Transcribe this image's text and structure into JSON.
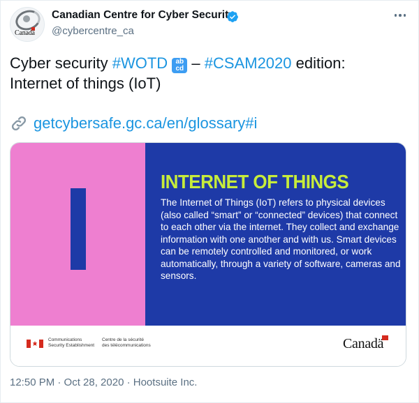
{
  "tweet": {
    "author_name": "Canadian Centre for Cyber Security",
    "author_handle": "@cybercentre_ca",
    "avatar_wordmark": "Canadä",
    "text_prefix": "Cyber security ",
    "hashtag_1": "#WOTD",
    "emoji_label": "abcd",
    "text_mid": " – ",
    "hashtag_2": "#CSAM2020",
    "text_suffix": " edition: Internet of things (IoT)",
    "link": "getcybersafe.gc.ca/en/glossary#i",
    "timestamp": "12:50 PM · Oct 28, 2020 · Hootsuite Inc."
  },
  "card": {
    "big_letter": "I",
    "title": "INTERNET OF THINGS",
    "body": "The Internet of Things (IoT) refers to physical devices (also called “smart” or “connected” devices) that connect to each other via the internet. They collect and exchange information with one another and with us. Smart devices can be remotely controlled and monitored, or work automatically, through a variety of software, cameras and sensors.",
    "dept_en_1": "Communications",
    "dept_en_2": "Security Establishment",
    "dept_fr_1": "Centre de la sécurité",
    "dept_fr_2": "des télécommunications",
    "wordmark": "Canadä"
  },
  "colors": {
    "link_blue": "#1b95e0",
    "pink": "#ee7fd0",
    "navy": "#1e3aa7",
    "lime": "#c7ec3b",
    "red": "#d52b1e"
  },
  "icons": [
    "verified-badge-icon",
    "more-options-icon",
    "link-icon",
    "canada-flag-icon",
    "abcd-emoji-icon"
  ]
}
